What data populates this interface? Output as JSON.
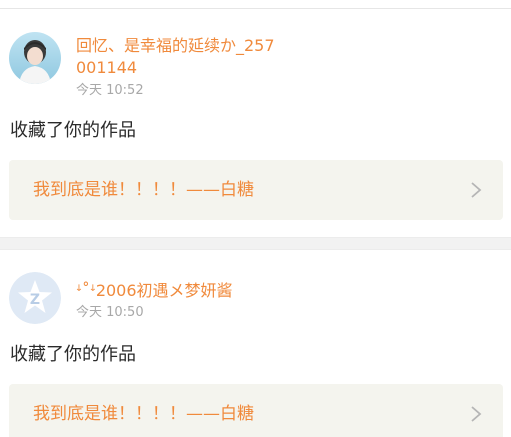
{
  "notifications": [
    {
      "username": "回忆、是幸福的延续か_257001144",
      "time": "今天 10:52",
      "action": "收藏了你的作品",
      "work_title": "我到底是谁！！！！——白糖",
      "avatar_icon": "user-photo-avatar"
    },
    {
      "username": "ꜜ˚ꜜ2006初遇メ梦妍酱",
      "time": "今天 10:50",
      "action": "收藏了你的作品",
      "work_title": "我到底是谁！！！！——白糖",
      "avatar_icon": "default-z-avatar"
    }
  ],
  "colors": {
    "accent": "#f08a3c",
    "time": "#a8a8a8",
    "box_bg": "#f4f4ee"
  }
}
